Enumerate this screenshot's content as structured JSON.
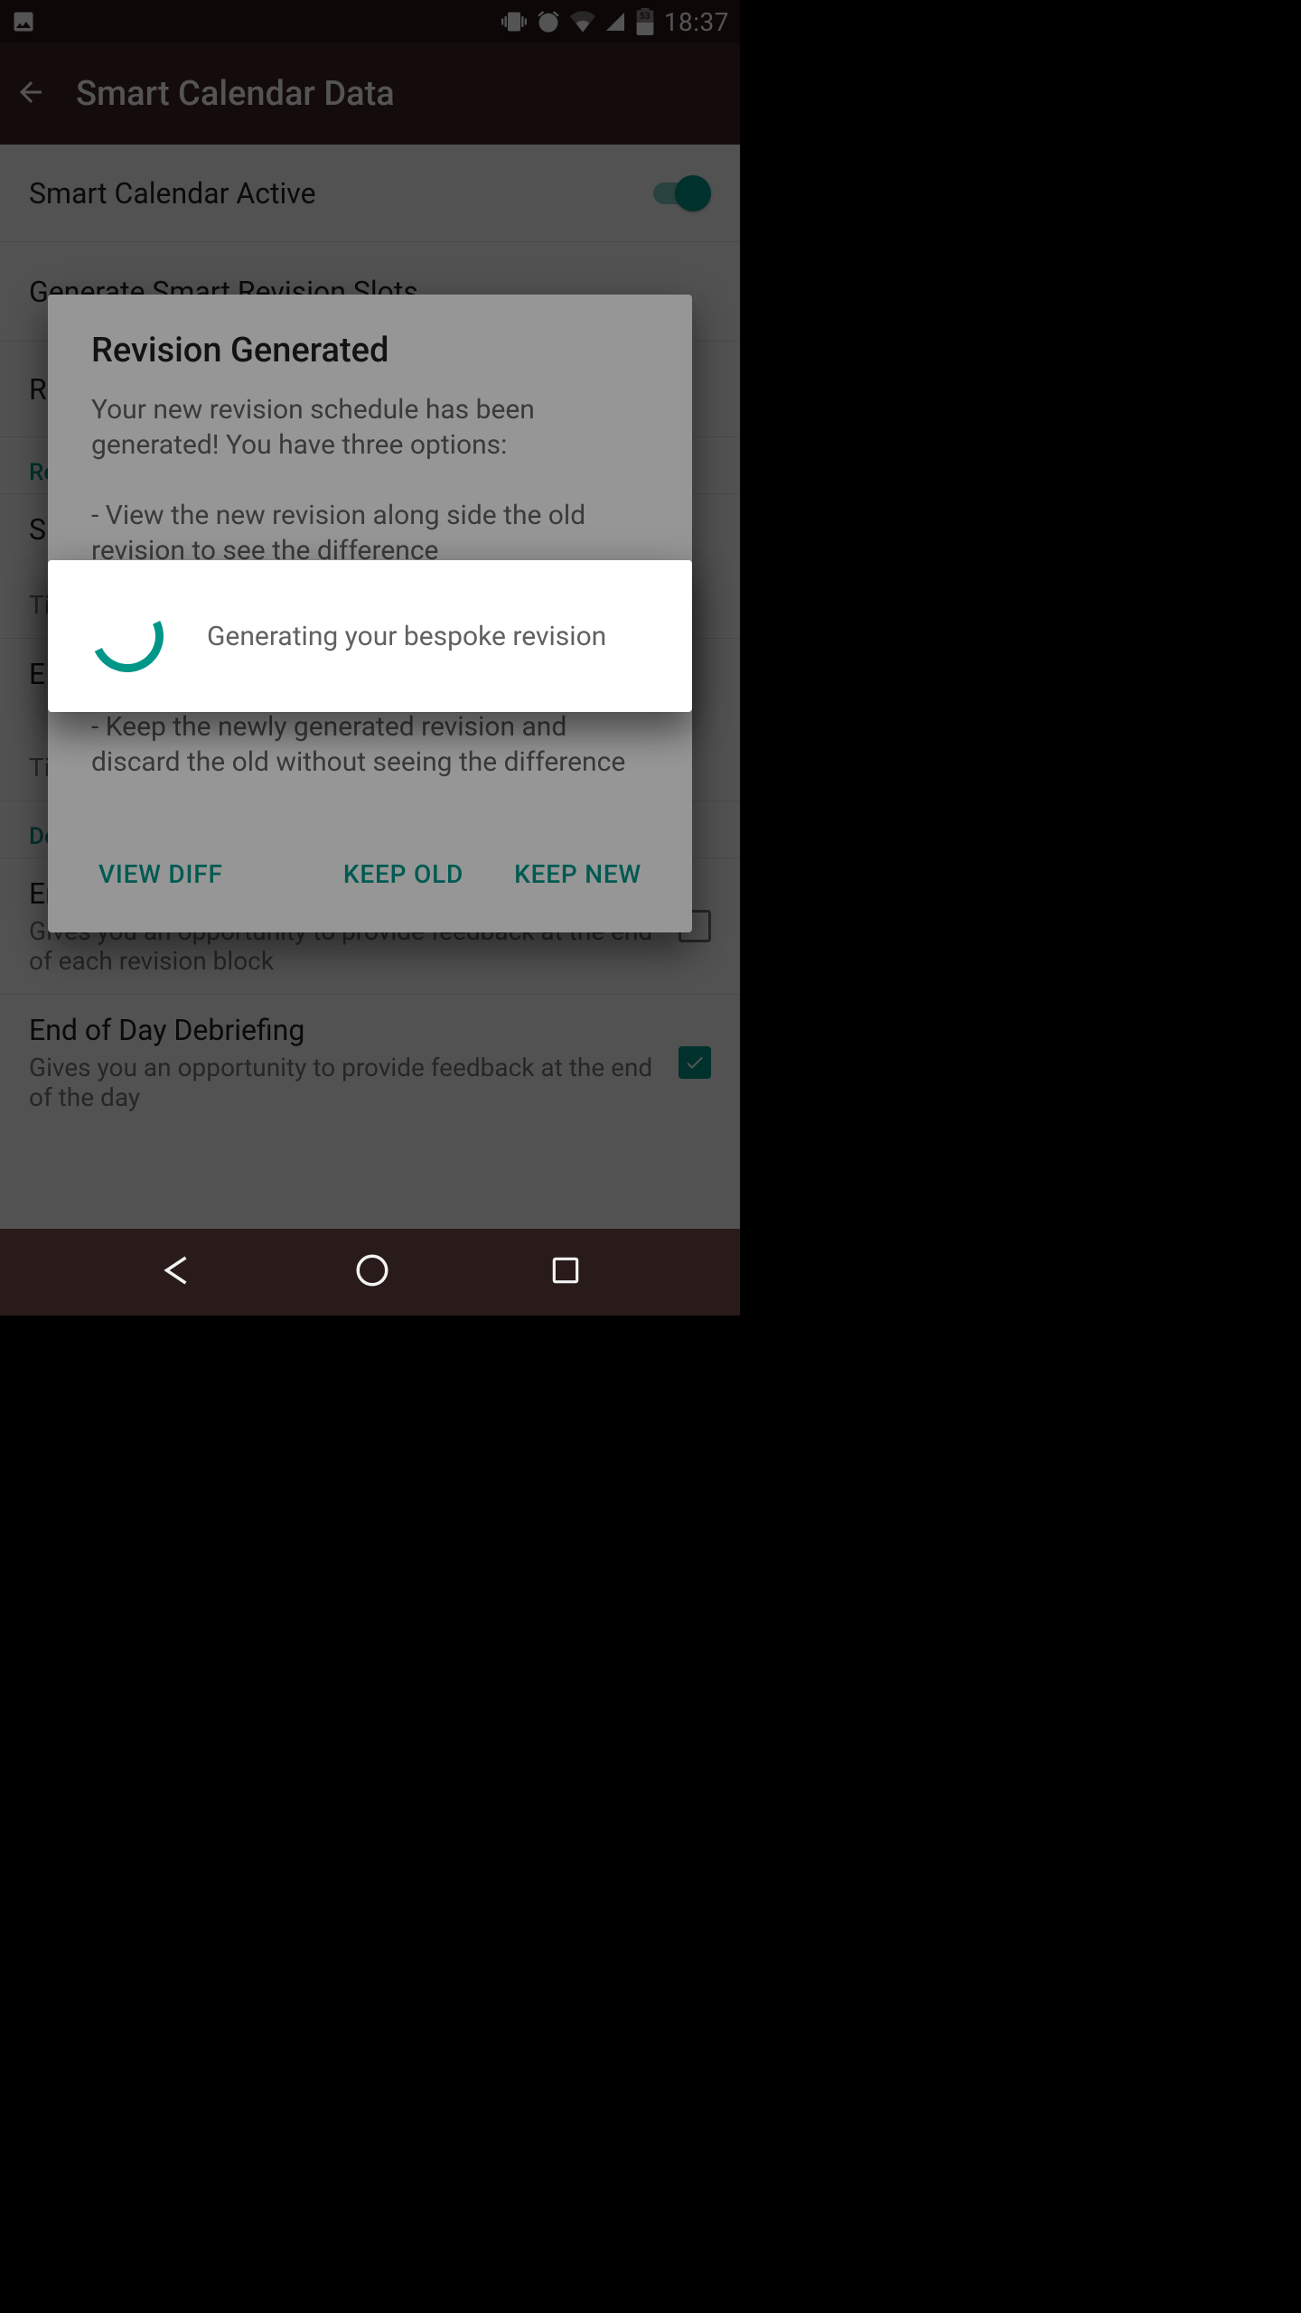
{
  "status": {
    "time": "18:37",
    "battery_label": "53",
    "icons": [
      "image-icon",
      "vibrate-icon",
      "alarm-icon",
      "wifi-icon",
      "cell-icon",
      "battery-icon"
    ]
  },
  "appbar": {
    "title": "Smart Calendar Data"
  },
  "settings": {
    "smart_active": {
      "label": "Smart Calendar Active",
      "on": true
    },
    "generate_slots": {
      "label": "Generate Smart Revision Slots"
    },
    "revision_intelligence_header": "Revision Intelligence",
    "start_time": {
      "label": "Start Time",
      "sub": "Set the time revision starts"
    },
    "end_time": {
      "label": "End Time",
      "sub": "Set the time revision ends"
    },
    "debrief_header": "Debriefing",
    "block_debrief": {
      "label": "End of Block Debriefing",
      "sub": "Gives you an opportunity to provide feedback at the end of each revision block",
      "checked": false
    },
    "day_debrief": {
      "label": "End of Day Debriefing",
      "sub": "Gives you an opportunity to provide feedback at the end of the day",
      "checked": true
    },
    "r_partial": "R",
    "s_partial": "S",
    "ti_partial": "Ti",
    "e_partial": "E"
  },
  "revision_dialog": {
    "title": "Revision Generated",
    "body": "Your new revision schedule has been generated! You have three options:\n\n   - View the new revision along side the old revision to see the difference\n\n   - Keep the old revision and discard the newly generated one\n\n   - Keep the newly generated revision and discard the old without seeing the difference",
    "view_diff": "VIEW DIFF",
    "keep_old": "KEEP OLD",
    "keep_new": "KEEP NEW"
  },
  "progress_dialog": {
    "text": "Generating your bespoke revision"
  },
  "colors": {
    "accent": "#009688",
    "appbar": "#3d2723",
    "status": "#281b19"
  }
}
